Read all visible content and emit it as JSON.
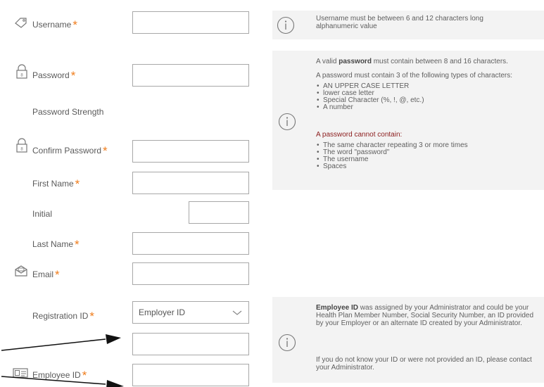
{
  "form": {
    "username": {
      "label": "Username",
      "value": ""
    },
    "password": {
      "label": "Password",
      "value": ""
    },
    "password_strength": {
      "label": "Password Strength"
    },
    "confirm_password": {
      "label": "Confirm Password",
      "value": ""
    },
    "first_name": {
      "label": "First Name",
      "value": ""
    },
    "initial": {
      "label": "Initial",
      "value": ""
    },
    "last_name": {
      "label": "Last Name",
      "value": ""
    },
    "email": {
      "label": "Email",
      "value": ""
    },
    "registration_id": {
      "label": "Registration ID",
      "selected": "Employer ID"
    },
    "employer_id_input": {
      "value": ""
    },
    "employee_id": {
      "label": "Employee ID",
      "value": ""
    },
    "required_mark": "*"
  },
  "help": {
    "username": "Username must be between 6 and 12 characters long alphanumeric value",
    "password": {
      "line1_pre": "A valid ",
      "line1_bold": "password",
      "line1_post": " must contain between 8 and 16 characters.",
      "line2": "A password must contain 3 of the following types of characters:",
      "must_items": [
        "AN UPPER CASE LETTER",
        "lower case letter",
        "Special Character (%, !, @, etc.)",
        "A number"
      ],
      "cannot_heading": "A password cannot contain:",
      "cannot_items": [
        "The same character repeating 3 or more times",
        "The word \"password\"",
        "The username",
        "Spaces"
      ]
    },
    "employee": {
      "bold": "Employee ID",
      "para1": " was assigned by your Administrator and could be your Health Plan Member Number, Social Security Number, an ID provided by your Employer or an alternate ID created by your Administrator.",
      "para2": "If you do not know your ID or were not provided an ID, please contact your Administrator."
    }
  },
  "icons": {
    "username": "tag-icon",
    "password": "lock-icon",
    "confirm_password": "lock-icon",
    "email": "envelope-icon",
    "employee_id": "id-card-icon",
    "info": "info-icon"
  },
  "colors": {
    "required": "#f07d1c",
    "warning": "#8b1c1c",
    "panel_bg": "#f3f3f3"
  }
}
